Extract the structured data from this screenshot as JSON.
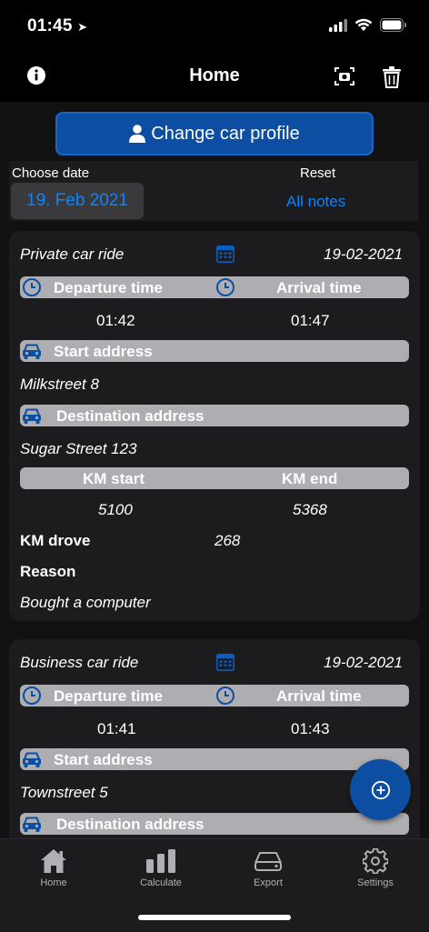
{
  "status": {
    "time": "01:45"
  },
  "nav": {
    "title": "Home"
  },
  "profile_button": {
    "label": "Change car profile"
  },
  "date_filter": {
    "choose_label": "Choose date",
    "date_value": "19. Feb 2021",
    "reset_label": "Reset",
    "all_notes": "All notes"
  },
  "rides": [
    {
      "type": "Private car ride",
      "date": "19-02-2021",
      "departure_label": "Departure time",
      "arrival_label": "Arrival time",
      "departure": "01:42",
      "arrival": "01:47",
      "start_label": "Start address",
      "start_address": "Milkstreet 8",
      "dest_label": "Destination address",
      "dest_address": "Sugar Street 123",
      "km_start_label": "KM start",
      "km_end_label": "KM end",
      "km_start": "5100",
      "km_end": "5368",
      "km_drove_label": "KM drove",
      "km_drove": "268",
      "reason_label": "Reason",
      "reason": "Bought a computer"
    },
    {
      "type": "Business car ride",
      "date": "19-02-2021",
      "departure_label": "Departure time",
      "arrival_label": "Arrival time",
      "departure": "01:41",
      "arrival": "01:43",
      "start_label": "Start address",
      "start_address": "Townstreet 5",
      "dest_label": "Destination address"
    }
  ],
  "tabs": [
    {
      "label": "Home",
      "icon": "home-icon"
    },
    {
      "label": "Calculate",
      "icon": "chart-icon"
    },
    {
      "label": "Export",
      "icon": "drive-icon"
    },
    {
      "label": "Settings",
      "icon": "gear-icon"
    }
  ],
  "colors": {
    "accent": "#0b4ea2",
    "link": "#0a84ff",
    "bar": "#aeaeb2",
    "card": "#1c1c1e"
  }
}
